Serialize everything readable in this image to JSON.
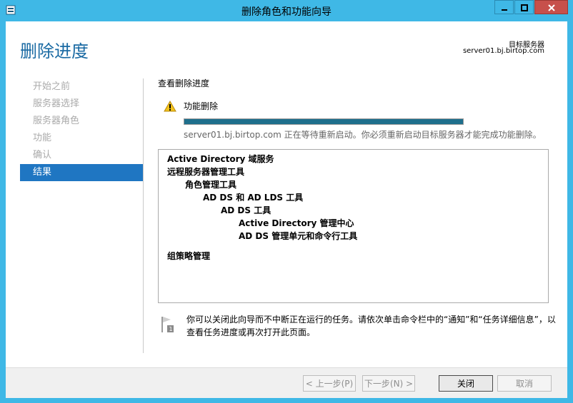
{
  "window": {
    "title": "删除角色和功能向导",
    "page_title": "删除进度",
    "destination_label": "目标服务器",
    "destination_server": "server01.bj.birtop.com"
  },
  "nav": {
    "items": [
      {
        "label": "开始之前"
      },
      {
        "label": "服务器选择"
      },
      {
        "label": "服务器角色"
      },
      {
        "label": "功能"
      },
      {
        "label": "确认"
      },
      {
        "label": "结果"
      }
    ],
    "active_index": 5
  },
  "main": {
    "section_title": "查看删除进度",
    "feature_label": "功能删除",
    "progress_percent": 100,
    "status_message": "server01.bj.birtop.com 正在等待重新启动。你必须重新启动目标服务器才能完成功能删除。",
    "tree": {
      "item1": "Active Directory 域服务",
      "item2": "远程服务器管理工具",
      "item3": "角色管理工具",
      "item4": "AD DS 和 AD LDS 工具",
      "item5": "AD DS 工具",
      "item6": "Active Directory 管理中心",
      "item7": "AD DS 管理单元和命令行工具",
      "item8": "组策略管理"
    },
    "note": "你可以关闭此向导而不中断正在运行的任务。请依次单击命令栏中的“通知”和“任务详细信息”，以查看任务进度或再次打开此页面。"
  },
  "footer": {
    "prev_label": "< 上一步(P)",
    "next_label": "下一步(N) >",
    "close_label": "关闭",
    "cancel_label": "取消"
  },
  "colors": {
    "frame": "#3fb8e6",
    "accent": "#1f76c2",
    "progress": "#1e6f8c",
    "close_button": "#c7504b"
  },
  "icons": {
    "app": "server-manager-icon",
    "minimize": "minimize-icon",
    "maximize": "maximize-icon",
    "close": "close-icon",
    "warning": "warning-icon",
    "notification": "notification-flag-icon"
  }
}
